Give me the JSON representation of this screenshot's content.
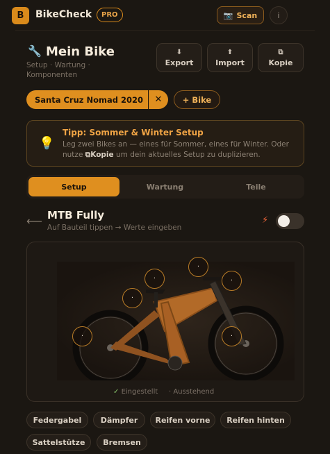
{
  "app": {
    "logo_letter": "B",
    "name": "BikeCheck",
    "badge": "PRO"
  },
  "topbar": {
    "scan_icon": "📷",
    "scan_label": "Scan",
    "info_label": "i"
  },
  "header": {
    "icon": "🔧",
    "title": "Mein Bike",
    "subtitle": "Setup · Wartung · Komponenten",
    "buttons": [
      {
        "icon": "⬇",
        "label": "Export"
      },
      {
        "icon": "⬆",
        "label": "Import"
      },
      {
        "icon": "⧉",
        "label": "Kopie"
      }
    ]
  },
  "bikes": {
    "selected": "Santa Cruz Nomad 2020",
    "remove": "✕",
    "add_label": "+ Bike"
  },
  "tip": {
    "icon": "💡",
    "title": "Tipp: Sommer & Winter Setup",
    "text_before": "Leg zwei Bikes an — eines für Sommer, eines für Winter. Oder nutze ",
    "copy_icon": "⧉",
    "copy_label": "Kopie",
    "text_after": " um dein aktuelles Setup zu duplizieren."
  },
  "tabs": [
    "Setup",
    "Wartung",
    "Teile"
  ],
  "section": {
    "back": "⟵",
    "title": "MTB Fully",
    "hint": "Auf Bauteil tippen → Werte eingeben",
    "bolt": "⚡"
  },
  "hotspot_label": "·",
  "legend": {
    "set_icon": "✓",
    "set": "Eingestellt",
    "pending_icon": "·",
    "pending": "Ausstehend"
  },
  "parts": [
    "Federgabel",
    "Dämpfer",
    "Reifen vorne",
    "Reifen hinten",
    "Sattelstütze",
    "Bremsen"
  ],
  "colors": {
    "accent": "#df8f1f",
    "background": "#1b1712"
  }
}
